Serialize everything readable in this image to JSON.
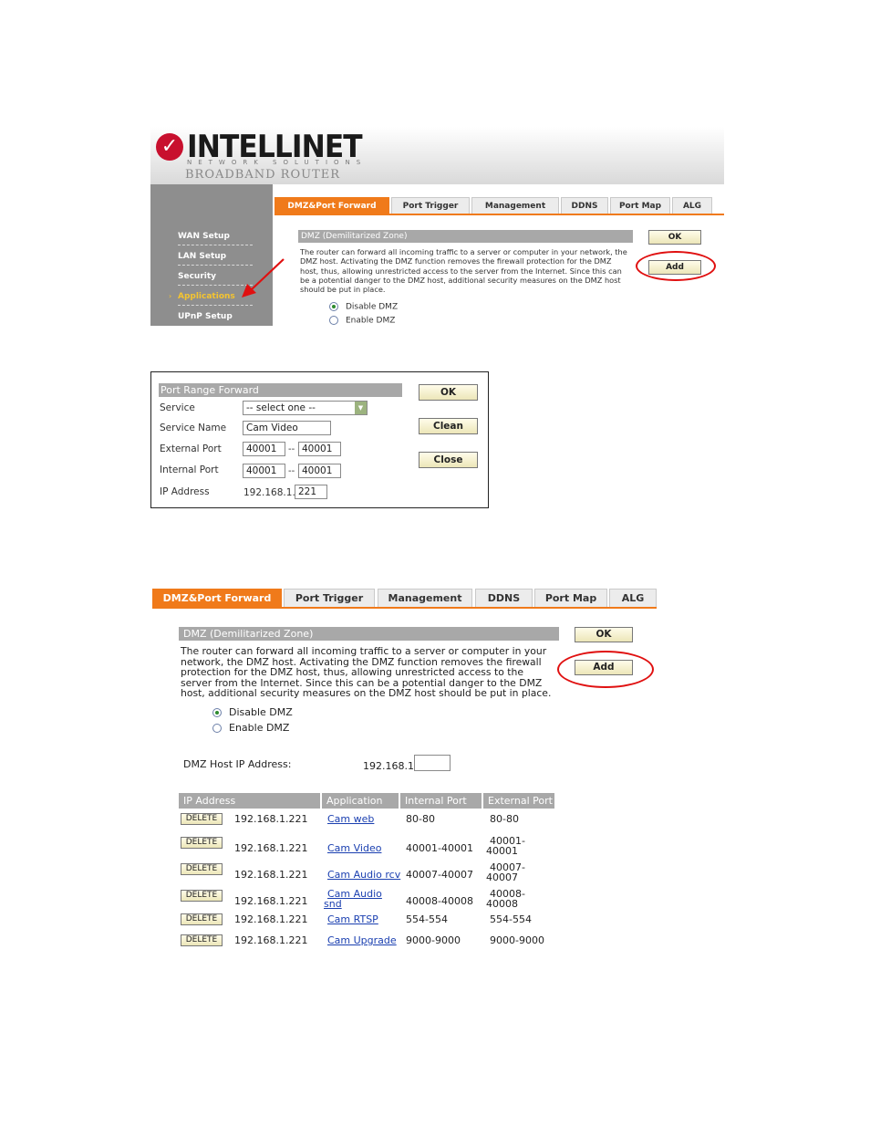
{
  "panel1": {
    "logo": {
      "brand": "INTELLINET",
      "sub": "NETWORK SOLUTIONS",
      "product": "BROADBAND ROUTER"
    },
    "sidebar": [
      "WAN Setup",
      "LAN Setup",
      "Security",
      "Applications",
      "UPnP Setup"
    ],
    "tabs": [
      "DMZ&Port Forward",
      "Port Trigger",
      "Management",
      "DDNS",
      "Port Map",
      "ALG"
    ],
    "section_title": "DMZ (Demilitarized Zone)",
    "description": "The router can forward all incoming traffic to a server or computer in your network, the DMZ host. Activating the DMZ function removes the firewall protection for the DMZ host, thus, allowing unrestricted access to the server from the Internet. Since this can be a potential danger to the DMZ host, additional security measures on the DMZ host should be put in place.",
    "radios": [
      "Disable DMZ",
      "Enable DMZ"
    ],
    "ok": "OK",
    "add": "Add"
  },
  "panel2": {
    "title": "Port Range Forward",
    "service_label": "Service",
    "service_value": "-- select one --",
    "service_name_label": "Service Name",
    "service_name_value": "Cam Video",
    "external_port_label": "External Port",
    "external_from": "40001",
    "external_to": "40001",
    "internal_port_label": "Internal Port",
    "internal_from": "40001",
    "internal_to": "40001",
    "ip_label": "IP Address",
    "ip_prefix": "192.168.1.",
    "ip_suffix": "221",
    "ok": "OK",
    "clean": "Clean",
    "close": "Close",
    "sep": "--"
  },
  "panel3": {
    "tabs": [
      "DMZ&Port Forward",
      "Port Trigger",
      "Management",
      "DDNS",
      "Port Map",
      "ALG"
    ],
    "section_title": "DMZ (Demilitarized Zone)",
    "description": "The router can forward all incoming traffic to a server or computer in your network, the DMZ host. Activating the DMZ function removes the firewall protection for the DMZ host, thus, allowing unrestricted access to the server from the Internet. Since this can be a potential danger to the DMZ host, additional security measures on the DMZ host should be put in place.",
    "radios": [
      "Disable DMZ",
      "Enable DMZ"
    ],
    "host_label": "DMZ Host IP Address:",
    "host_prefix": "192.168.1.",
    "ok": "OK",
    "add": "Add",
    "table": {
      "headers": [
        "IP Address",
        "Application",
        "Internal Port",
        "External Port"
      ],
      "delete_label": "DELETE",
      "rows": [
        {
          "ip": "192.168.1.221",
          "app1": "Cam web",
          "app2": "",
          "internal": "80-80",
          "ext1": "80-80",
          "ext2": ""
        },
        {
          "ip": "192.168.1.221",
          "app1": "Cam Video",
          "app2": "",
          "internal": "40001-40001",
          "ext1": "40001-",
          "ext2": "40001"
        },
        {
          "ip": "192.168.1.221",
          "app1": "Cam Audio rcv",
          "app2": "",
          "internal": "40007-40007",
          "ext1": "40007-",
          "ext2": "40007"
        },
        {
          "ip": "192.168.1.221",
          "app1": "Cam Audio",
          "app2": "snd",
          "internal": "40008-40008",
          "ext1": "40008-",
          "ext2": "40008"
        },
        {
          "ip": "192.168.1.221",
          "app1": "Cam RTSP",
          "app2": "",
          "internal": "554-554",
          "ext1": "554-554",
          "ext2": ""
        },
        {
          "ip": "192.168.1.221",
          "app1": "Cam Upgrade",
          "app2": "",
          "internal": "9000-9000",
          "ext1": "9000-9000",
          "ext2": ""
        }
      ]
    }
  }
}
